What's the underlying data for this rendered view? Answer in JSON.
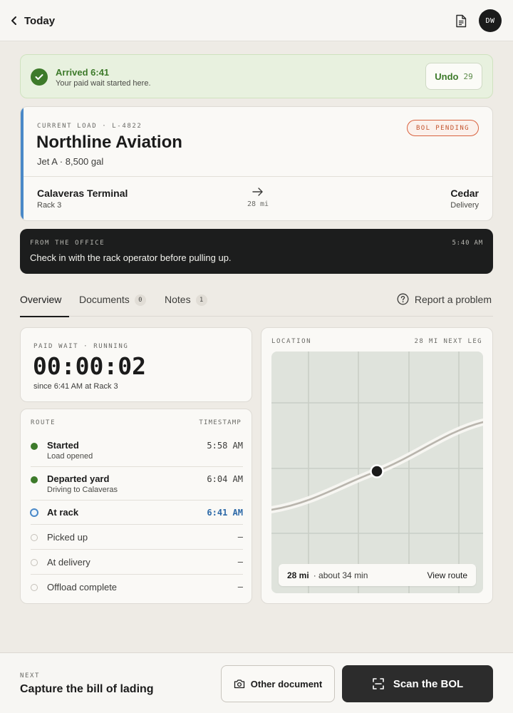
{
  "header": {
    "back_label": "Today",
    "avatar_initials": "DW",
    "icons": [
      "chevron-left-icon",
      "document-icon"
    ]
  },
  "arrival": {
    "title": "Arrived 6:41",
    "subtitle": "Your paid wait started here.",
    "undo_label": "Undo",
    "undo_countdown": "29"
  },
  "load": {
    "eyebrow": "CURRENT LOAD · L-4822",
    "customer": "Northline Aviation",
    "product": "Jet A · 8,500 gal",
    "badge": "BOL PENDING",
    "origin_name": "Calaveras Terminal",
    "origin_sub": "Rack 3",
    "distance": "28 mi",
    "destination_name": "Cedar",
    "destination_sub": "Delivery"
  },
  "office": {
    "label": "FROM THE OFFICE",
    "time": "5:40 AM",
    "message": "Check in with the rack operator before pulling up."
  },
  "tabs": {
    "overview": "Overview",
    "documents": "Documents",
    "documents_count": "0",
    "notes": "Notes",
    "notes_count": "1",
    "report": "Report a problem"
  },
  "wait": {
    "label": "PAID WAIT · RUNNING",
    "timer": "00:00:02",
    "since": "since 6:41 AM at Rack 3"
  },
  "route": {
    "header": "ROUTE",
    "timestamp_header": "TIMESTAMP",
    "steps": [
      {
        "name": "Started",
        "desc": "Load opened",
        "time": "5:58 AM",
        "state": "done"
      },
      {
        "name": "Departed yard",
        "desc": "Driving to Calaveras",
        "time": "6:04 AM",
        "state": "done"
      },
      {
        "name": "At rack",
        "desc": "",
        "time": "6:41 AM",
        "state": "current"
      },
      {
        "name": "Picked up",
        "desc": "",
        "time": "–",
        "state": "todo"
      },
      {
        "name": "At delivery",
        "desc": "",
        "time": "–",
        "state": "todo"
      },
      {
        "name": "Offload complete",
        "desc": "",
        "time": "–",
        "state": "todo"
      }
    ]
  },
  "location": {
    "header": "LOCATION",
    "next_leg": "28 MI NEXT LEG",
    "miles": "28 mi",
    "duration": "· about 34 min",
    "view_route": "View route"
  },
  "next": {
    "label": "NEXT",
    "title": "Capture the bill of lading",
    "other_button": "Other document",
    "scan_button": "Scan the BOL"
  },
  "colors": {
    "accent_green": "#3d7a2a",
    "accent_blue": "#4a89c8",
    "badge_orange": "#d9623f",
    "dark": "#1c1d1d"
  }
}
